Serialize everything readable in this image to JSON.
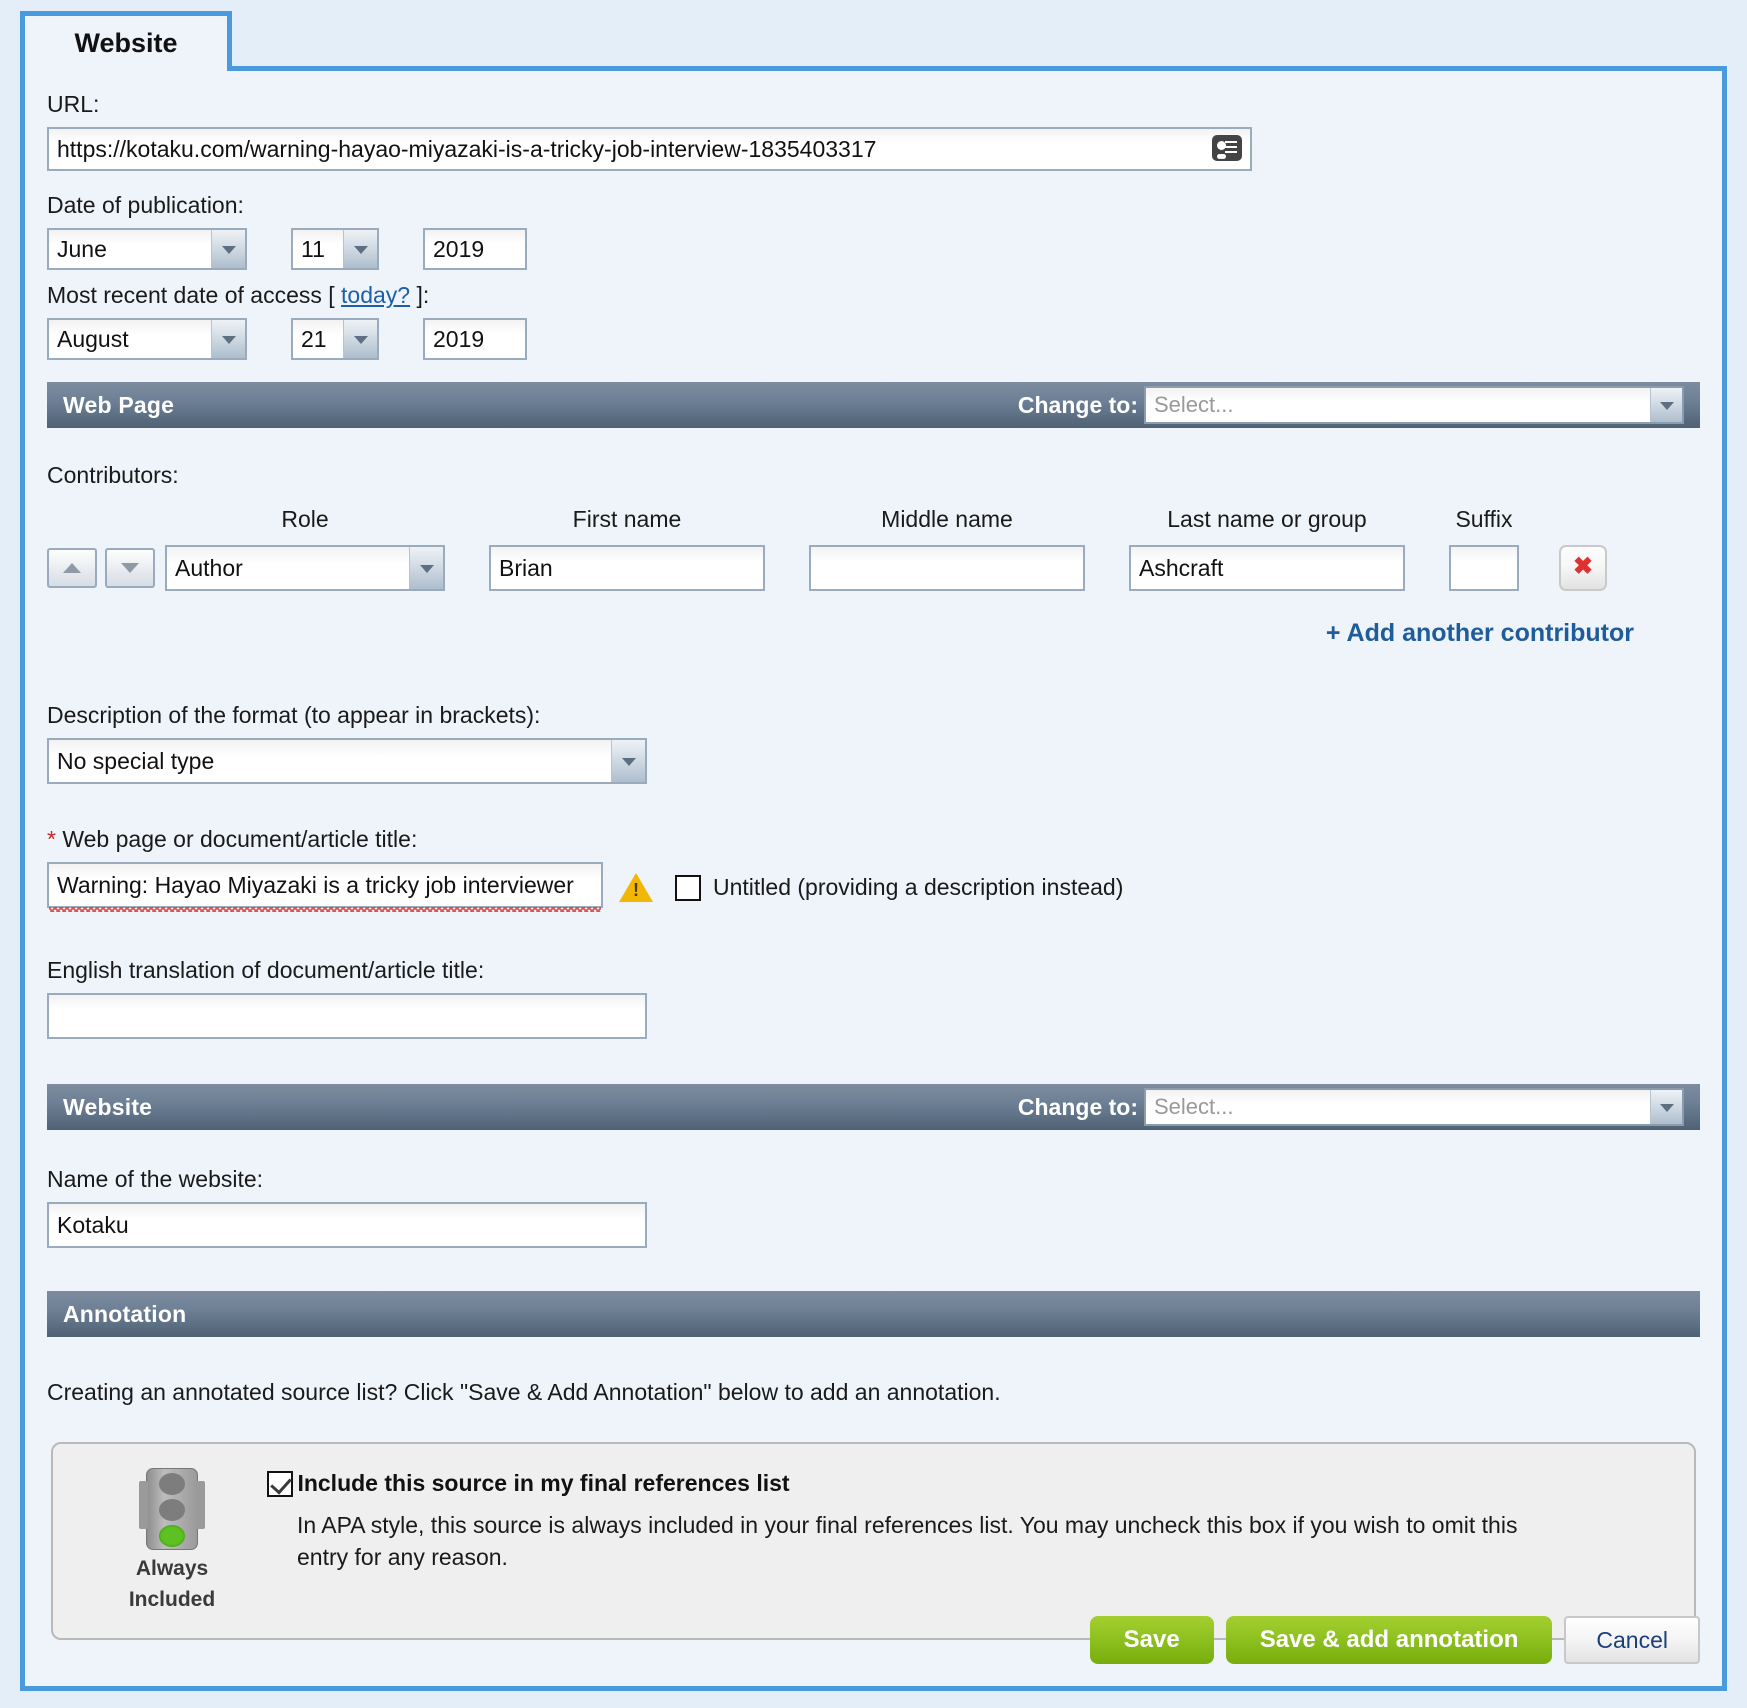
{
  "tab": {
    "label": "Website"
  },
  "url_section": {
    "label": "URL:",
    "value": "https://kotaku.com/warning-hayao-miyazaki-is-a-tricky-job-interview-1835403317",
    "autofill_icon": "id-card-icon"
  },
  "publication": {
    "label": "Date of publication:",
    "month": "June",
    "day": "11",
    "year": "2019"
  },
  "access": {
    "label_before": "Most recent date of access [",
    "today_link": "today?",
    "label_after": "]:",
    "month": "August",
    "day": "21",
    "year": "2019"
  },
  "webpage_section": {
    "title": "Web Page",
    "change_to_label": "Change to:",
    "change_to_value": "Select...",
    "contributors_label": "Contributors:",
    "columns": {
      "role": "Role",
      "first": "First name",
      "middle": "Middle name",
      "last": "Last name or group",
      "suffix": "Suffix"
    },
    "contributor": {
      "role": "Author",
      "first": "Brian",
      "middle": "",
      "last": "Ashcraft",
      "suffix": ""
    },
    "add_contributor": "+ Add another contributor",
    "format_label": "Description of the format (to appear in brackets):",
    "format_value": "No special type",
    "title_label_star": "*",
    "title_label": "Web page or document/article title:",
    "title_value": "Warning: Hayao Miyazaki is a tricky job interviewer",
    "untitled_label": "Untitled (providing a description instead)",
    "untitled_checked": false,
    "translation_label": "English translation of document/article title:",
    "translation_value": ""
  },
  "website_section": {
    "title": "Website",
    "change_to_label": "Change to:",
    "change_to_value": "Select...",
    "name_label": "Name of the website:",
    "name_value": "Kotaku"
  },
  "annotation_section": {
    "title": "Annotation",
    "text": "Creating an annotated source list? Click \"Save & Add Annotation\" below to add an annotation."
  },
  "include_box": {
    "traffic_icon": "traffic-light-icon",
    "traffic_label_line1": "Always",
    "traffic_label_line2": "Included",
    "checkbox_checked": true,
    "title": "Include this source in my final references list",
    "description": "In APA style, this source is always included in your final references list. You may uncheck this box if you wish to omit this entry for any reason."
  },
  "footer": {
    "save": "Save",
    "save_add_annotation": "Save & add annotation",
    "cancel": "Cancel"
  },
  "colors": {
    "accent_border": "#4a9ae0",
    "panel_bg": "#eef4f9",
    "page_bg": "#e3eef8",
    "section_bar": "#6e8096",
    "link": "#1e5c9c",
    "save_green": "#8fc221",
    "warning": "#f2b705",
    "error_red": "#e04040"
  }
}
